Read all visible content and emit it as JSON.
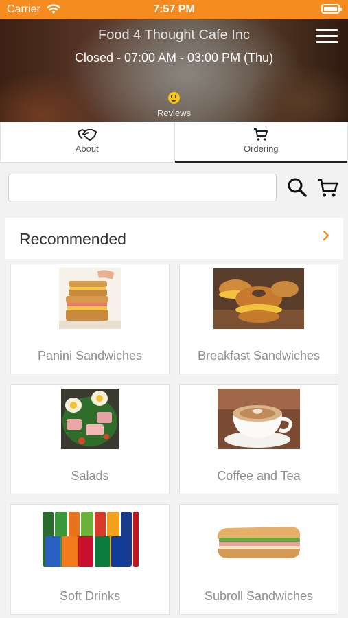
{
  "status_bar": {
    "carrier": "Carrier",
    "time": "7:57 PM"
  },
  "header": {
    "title": "Food 4 Thought Cafe Inc",
    "hours": "Closed - 07:00 AM - 03:00 PM (Thu)",
    "reviews_label": "Reviews"
  },
  "tabs": [
    {
      "label": "About",
      "icon": "handshake-icon",
      "active": false
    },
    {
      "label": "Ordering",
      "icon": "cart-icon",
      "active": true
    }
  ],
  "search": {
    "value": "",
    "placeholder": ""
  },
  "section": {
    "title": "Recommended"
  },
  "categories": [
    {
      "label": "Panini Sandwiches"
    },
    {
      "label": "Breakfast Sandwiches"
    },
    {
      "label": "Salads"
    },
    {
      "label": "Coffee and Tea"
    },
    {
      "label": "Soft Drinks"
    },
    {
      "label": "Subroll Sandwiches"
    }
  ],
  "colors": {
    "accent": "#f68b1f",
    "status_bar": "#f68b1f",
    "tab_indicator": "#222222"
  }
}
